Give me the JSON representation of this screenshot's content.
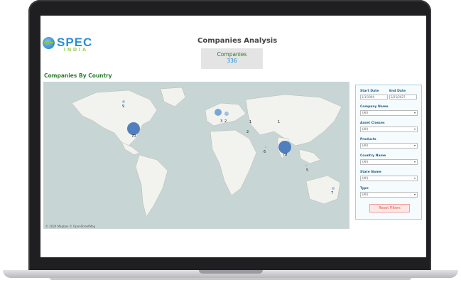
{
  "brand": {
    "name_top": "SPEC",
    "name_bottom": "INDIA"
  },
  "dashboard": {
    "title": "Companies Analysis",
    "kpi": {
      "label": "Companies",
      "value": "336"
    },
    "map_title": "Companies By Country",
    "map_attribution": "© 2024 Mapbox © OpenStreetMap"
  },
  "map_bubbles": [
    {
      "label": "70",
      "size": "large"
    },
    {
      "label": "78",
      "size": "large"
    },
    {
      "label": "9",
      "size": "small"
    },
    {
      "label": "",
      "size": "medium"
    },
    {
      "label": "",
      "size": "small"
    },
    {
      "label": "2",
      "size": "tiny"
    },
    {
      "label": "3",
      "size": "tiny"
    },
    {
      "label": "1",
      "size": "tiny"
    },
    {
      "label": "6",
      "size": "tiny"
    },
    {
      "label": "5",
      "size": "tiny"
    },
    {
      "label": "7",
      "size": "tiny"
    },
    {
      "label": "1",
      "size": "tiny"
    },
    {
      "label": "2",
      "size": "tiny"
    }
  ],
  "filters": {
    "start_date_label": "Start Date",
    "start_date_value": "1/1/1994",
    "end_date_label": "End Date",
    "end_date_value": "3/25/2027",
    "company_name_label": "Company Name",
    "company_name_value": "(All)",
    "asset_classes_label": "Asset Classes",
    "asset_classes_value": "(All)",
    "products_label": "Products",
    "products_value": "(All)",
    "country_name_label": "Country Name",
    "country_name_value": "(All)",
    "state_name_label": "State Name",
    "state_name_value": "(All)",
    "type_label": "Type",
    "type_value": "(All)",
    "reset_label": "Reset Filters"
  },
  "colors": {
    "accent_green": "#2c7a2c",
    "accent_blue": "#1f8ed6",
    "bubble": "#4f7fbe",
    "reset": "#e0554b"
  }
}
